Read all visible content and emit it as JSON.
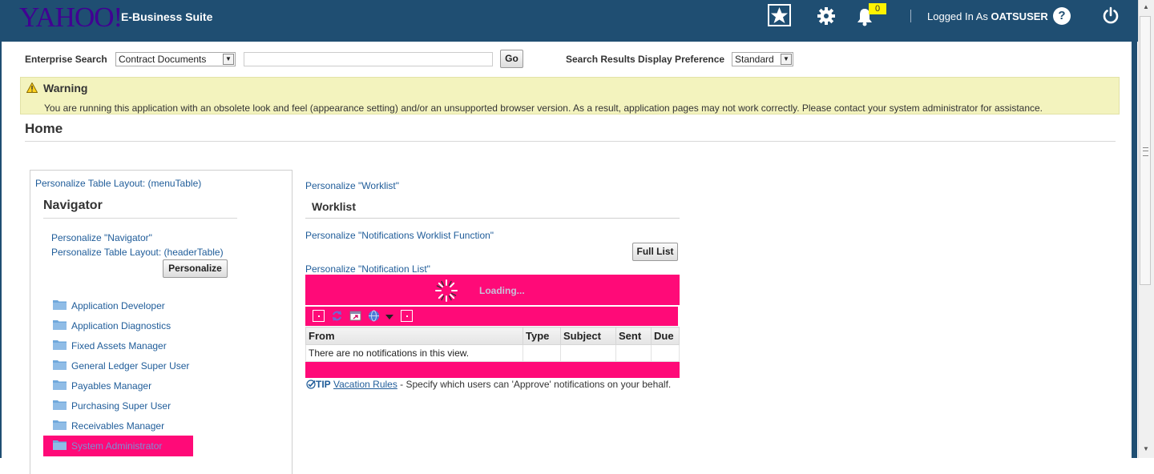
{
  "header": {
    "logo": "YAHOO!",
    "suite_name": "E-Business Suite",
    "notification_count": "0",
    "logged_in_label": "Logged In As",
    "username": "OATSUSER",
    "help": "?",
    "bar_color": "#1f4e72"
  },
  "search": {
    "enterprise_label": "Enterprise Search",
    "category_selected": "Contract Documents",
    "query_value": "",
    "go_label": "Go",
    "display_pref_label": "Search Results Display Preference",
    "display_pref_selected": "Standard"
  },
  "warning": {
    "title": "Warning",
    "message": "You are running this application with an obsolete look and feel (appearance setting) and/or an unsupported browser version. As a result, application pages may not work correctly. Please contact your system administrator for assistance.",
    "bg_color": "#f3f3be"
  },
  "page": {
    "title": "Home"
  },
  "navigator": {
    "personalize_table_layout_menu": "Personalize Table Layout: (menuTable)",
    "title": "Navigator",
    "personalize_navigator": "Personalize \"Navigator\"",
    "personalize_table_layout_header": "Personalize Table Layout: (headerTable)",
    "personalize_button": "Personalize",
    "items": [
      {
        "label": "Application Developer"
      },
      {
        "label": "Application Diagnostics"
      },
      {
        "label": "Fixed Assets Manager"
      },
      {
        "label": "General Ledger Super User"
      },
      {
        "label": "Payables Manager"
      },
      {
        "label": "Purchasing Super User"
      },
      {
        "label": "Receivables Manager"
      },
      {
        "label": "System Administrator",
        "selected": true
      }
    ],
    "highlight_color": "#ff0a78"
  },
  "worklist": {
    "personalize_worklist": "Personalize \"Worklist\"",
    "title": "Worklist",
    "personalize_nwf": "Personalize \"Notifications Worklist Function\"",
    "full_list_button": "Full List",
    "personalize_nlist": "Personalize \"Notification List\"",
    "loading_text": "Loading...",
    "columns": [
      "From",
      "Type",
      "Subject",
      "Sent",
      "Due"
    ],
    "empty_message": "There are no notifications in this view.",
    "tip_label": "TIP",
    "tip_link": "Vacation Rules",
    "tip_text": " - Specify which users can 'Approve' notifications on your behalf.",
    "toolbar_icons": [
      "select-all-icon",
      "refresh-icon",
      "detach-icon",
      "view-icon",
      "dropdown-arrow-icon",
      "select-none-icon"
    ]
  }
}
